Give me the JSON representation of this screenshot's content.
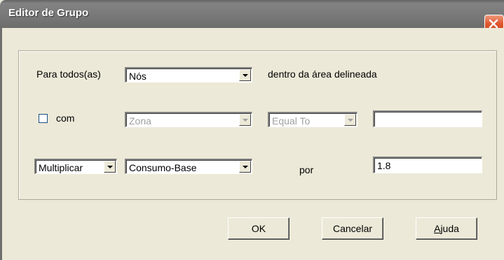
{
  "window": {
    "title": "Editor de Grupo"
  },
  "row1": {
    "label_prefix": "Para todos(as)",
    "object_type_value": "Nós",
    "label_suffix": "dentro da área delineada"
  },
  "row2": {
    "checkbox_label": "com",
    "checkbox_checked": false,
    "filter_property_value": "Zona",
    "filter_relation_value": "Equal To",
    "filter_value": ""
  },
  "row3": {
    "action_value": "Multiplicar",
    "property_value": "Consumo-Base",
    "label_by": "por",
    "amount_value": "1.8"
  },
  "buttons": {
    "ok_label": "OK",
    "cancel_label": "Cancelar",
    "help_label": "Ajuda"
  },
  "icons": {
    "close": "close-icon",
    "dropdown": "chevron-down-icon"
  },
  "colors": {
    "face": "#ece9d8",
    "close_button": "#e0582f",
    "disabled_text": "#a0a0a0"
  }
}
